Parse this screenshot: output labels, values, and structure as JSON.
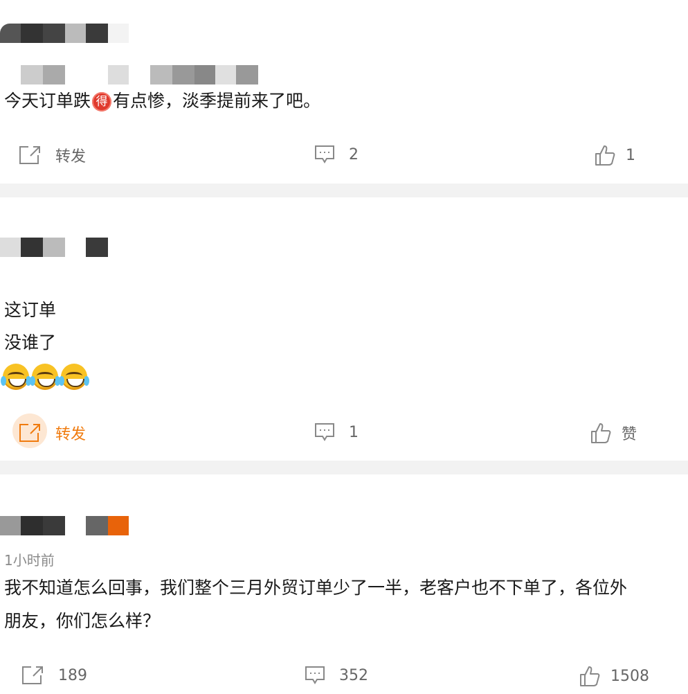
{
  "posts": [
    {
      "text": "今天订单跌{de}有点惨，淡季提前来了吧。",
      "text_before": "今天订单跌",
      "badge": "得",
      "text_after": "有点惨，淡季提前来了吧。",
      "repost_label": "转发",
      "comment_count": "2",
      "like_label": "1"
    },
    {
      "lines": [
        "这订单",
        "没谁了"
      ],
      "emoji": "laugh-cry-emoji",
      "emoji_count": 3,
      "repost_label": "转发",
      "comment_count": "1",
      "like_label": "赞",
      "repost_active": true
    },
    {
      "time": "1小时前",
      "line1": "我不知道怎么回事，我们整个三月外贸订单少了一半，老客户也不下单了，各位外",
      "line2": "朋友，你们怎么样？",
      "repost_label": "189",
      "comment_count": "352",
      "like_label": "1508"
    }
  ],
  "colors": {
    "accent": "#f07b0e",
    "separator": "#f2f2f2",
    "muted": "#666666",
    "badge": "#e03a2d"
  },
  "icons": {
    "repost": "share-icon",
    "comment": "comment-icon",
    "like": "thumbs-up-icon"
  }
}
